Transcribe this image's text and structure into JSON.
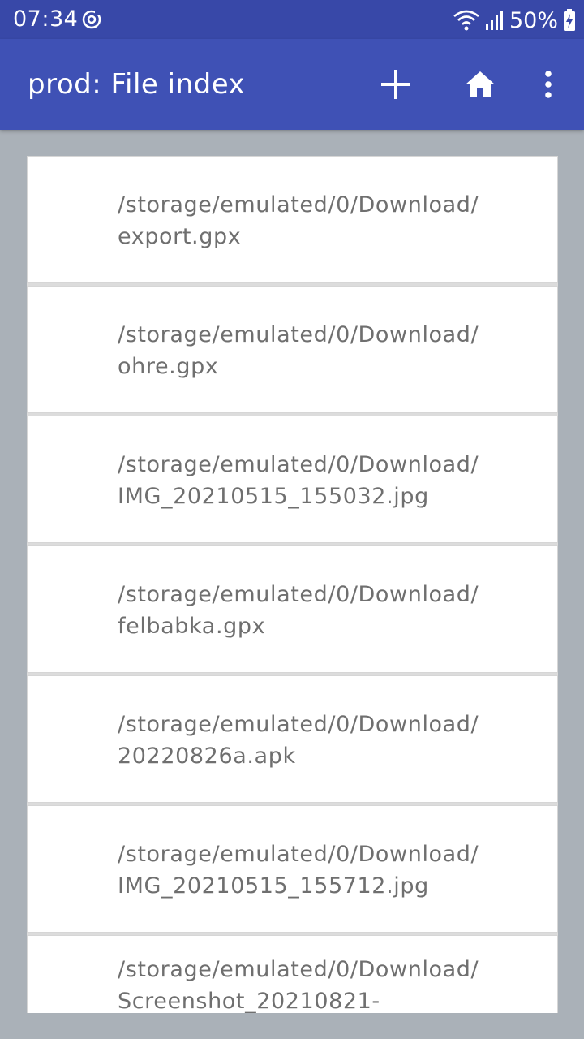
{
  "status_bar": {
    "time": "07:34",
    "battery": "50%",
    "icons": [
      "sync-icon",
      "wifi-icon",
      "signal-icon",
      "battery-charging-icon"
    ]
  },
  "app_bar": {
    "title": "prod: File index",
    "actions": [
      "add-icon",
      "home-icon",
      "more-vert-icon"
    ]
  },
  "files": [
    {
      "line1": "/storage/emulated/0/Download/",
      "line2": "export.gpx"
    },
    {
      "line1": "/storage/emulated/0/Download/",
      "line2": "ohre.gpx"
    },
    {
      "line1": "/storage/emulated/0/Download/",
      "line2": "IMG_20210515_155032.jpg"
    },
    {
      "line1": "/storage/emulated/0/Download/",
      "line2": "felbabka.gpx"
    },
    {
      "line1": "/storage/emulated/0/Download/",
      "line2": "20220826a.apk"
    },
    {
      "line1": "/storage/emulated/0/Download/",
      "line2": "IMG_20210515_155712.jpg"
    },
    {
      "line1": "/storage/emulated/0/Download/",
      "line2": "Screenshot_20210821-"
    }
  ],
  "colors": {
    "app_bar": "#3f51b5",
    "status_bar": "#3848a8",
    "background": "#aab1b8",
    "text": "#6f6f6f"
  }
}
